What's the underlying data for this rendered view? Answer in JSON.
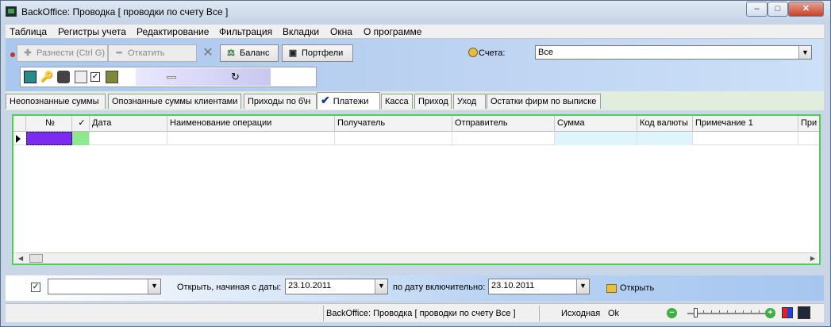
{
  "window": {
    "title": "BackOffice: Проводка [ проводки по счету Все ]",
    "buttons": {
      "minimize": "–",
      "maximize": "□",
      "close": "✕"
    }
  },
  "menu": [
    "Таблица",
    "Регистры учета",
    "Редактирование",
    "Фильтрация",
    "Вкладки",
    "Окна",
    "О программе"
  ],
  "toolbar": {
    "post_label": "Разнести (Ctrl G)",
    "rollback_label": "Откатить",
    "balance_label": "Баланс",
    "portfolio_label": "Портфели",
    "accounts_label": "Счета:",
    "accounts_value": "Все"
  },
  "tabs": [
    {
      "label": "Неопознанные суммы"
    },
    {
      "label": "Опознанные суммы клиентами"
    },
    {
      "label": "Приходы по б\\н"
    },
    {
      "label": "Платежи"
    },
    {
      "label": "Касса"
    },
    {
      "label": "Приход"
    },
    {
      "label": "Уход"
    },
    {
      "label": "Остатки фирм по выписке"
    }
  ],
  "grid": {
    "columns": [
      "№",
      "✓",
      "Дата",
      "Наименование операции",
      "Получатель",
      "Отправитель",
      "Сумма",
      "Код валюты",
      "Примечание 1",
      "При"
    ]
  },
  "filter": {
    "open_from_label": "Открыть, начиная с даты:",
    "from_date": "23.10.2011",
    "to_label": "по дату включительно:",
    "to_date": "23.10.2011",
    "open_label": "Открыть"
  },
  "status": {
    "window_title": "BackOffice: Проводка [ проводки по счету Все ]",
    "mode": "Исходная",
    "state": "Ok"
  },
  "colors": {
    "grid_border": "#4fcf4f",
    "row_selected": "#7b2cf0",
    "sum_column": "#e0f4fc"
  }
}
